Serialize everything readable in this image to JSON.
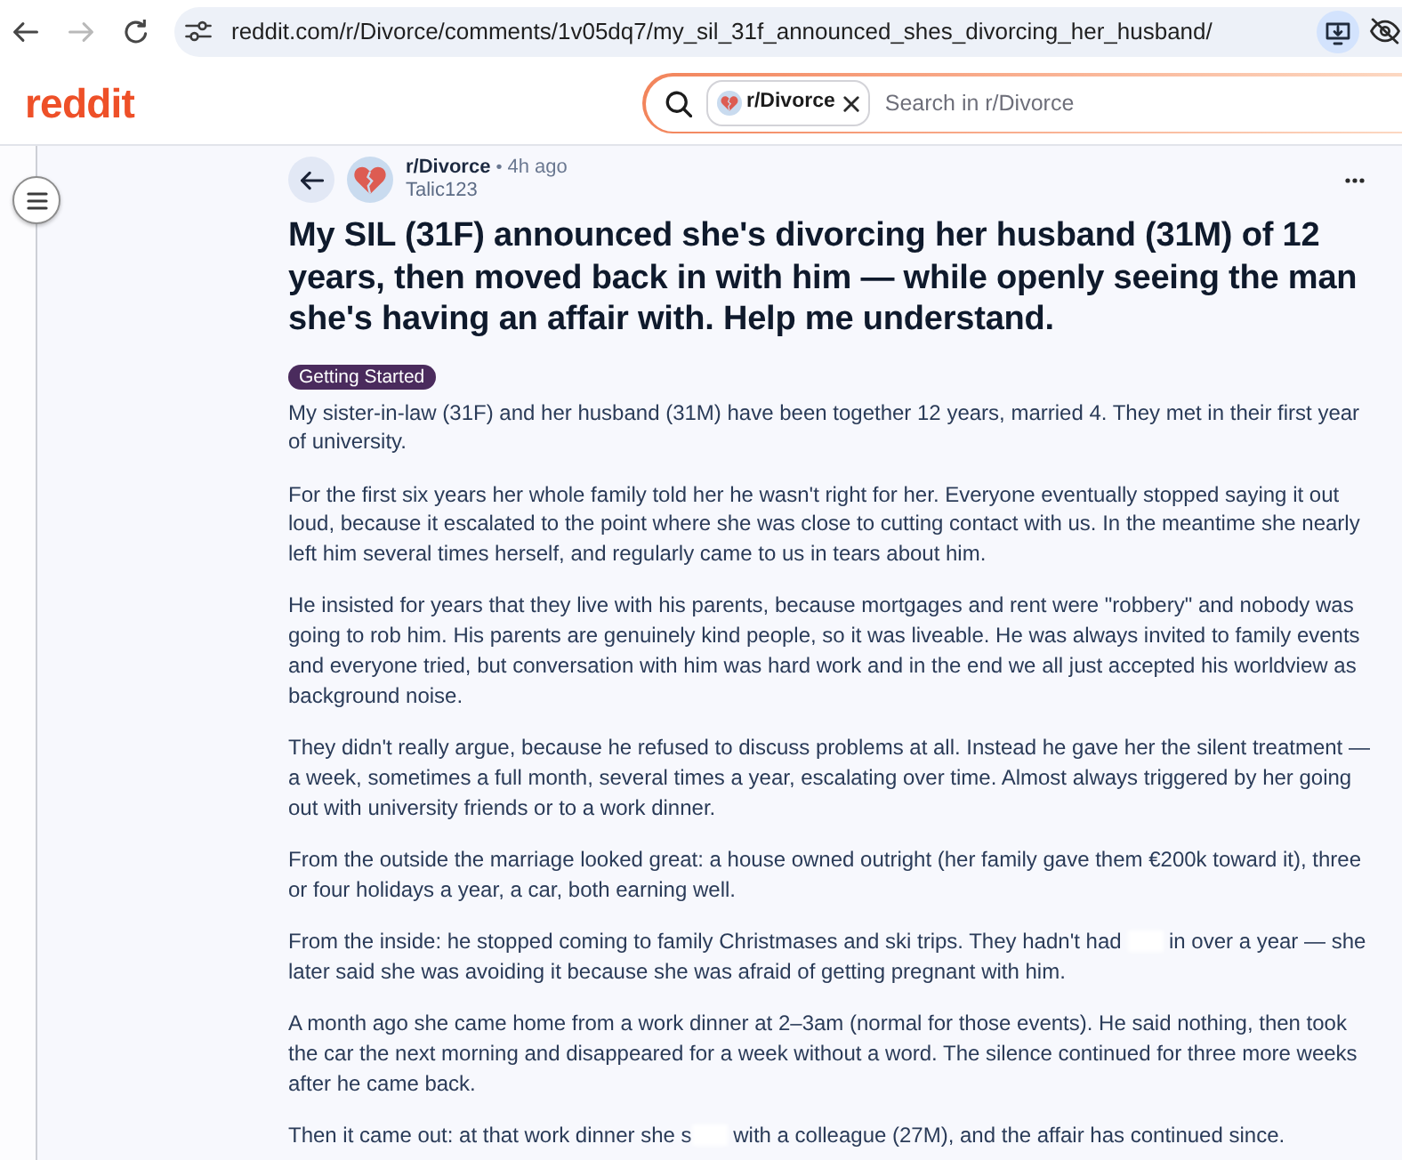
{
  "browser": {
    "nav": [
      {
        "kind": "back",
        "disabled": false
      },
      {
        "kind": "forward",
        "disabled": true
      },
      {
        "kind": "reload",
        "disabled": false
      }
    ],
    "url": "reddit.com/r/Divorce/comments/1v05dq7/my_sil_31f_announced_shes_divorcing_her_husband/"
  },
  "header": {
    "logo": "reddit",
    "search": {
      "chip": "r/Divorce",
      "placeholder": "Search in r/Divorce"
    }
  },
  "post": {
    "subreddit": "r/Divorce",
    "separator": "•",
    "time": "4h ago",
    "author": "Talic123",
    "title": "My SIL (31F) announced she's divorcing her husband (31M) of 12 years, then moved back in with him — while openly seeing the man she's having an affair with. Help me understand.",
    "flair": "Getting Started",
    "paragraphs": [
      {
        "segments": [
          {
            "kind": "text",
            "text": "My sister-in-law (31F) and her husband (31M) have been together 12 years, married 4. They met in their first year of university."
          }
        ]
      },
      {
        "segments": [
          {
            "kind": "text",
            "text": "For the first six years her whole family told her he wasn't right for her. Everyone eventually stopped saying it out loud, because it escalated to the point where she was close to cutting contact with us. In the meantime she nearly left him several times herself, and regularly came to us in tears about him."
          }
        ]
      },
      {
        "segments": [
          {
            "kind": "text",
            "text": "He insisted for years that they live with his parents, because mortgages and rent were \"robbery\" and nobody was going to rob him. His parents are genuinely kind people, so it was liveable. He was always invited to family events and everyone tried, but conversation with him was hard work and in the end we all just accepted his worldview as background noise."
          }
        ]
      },
      {
        "segments": [
          {
            "kind": "text",
            "text": "They didn't really argue, because he refused to discuss problems at all. Instead he gave her the silent treatment — a week, sometimes a full month, several times a year, escalating over time. Almost always triggered by her going out with university friends or to a work dinner."
          }
        ]
      },
      {
        "segments": [
          {
            "kind": "text",
            "text": "From the outside the marriage looked great: a house owned outright (her family gave them €200k toward it), three or four holidays a year, a car, both earning well."
          }
        ]
      },
      {
        "segments": [
          {
            "kind": "text",
            "text": "From the inside: he stopped coming to family Christmases and ski trips. They hadn't had "
          },
          {
            "kind": "redacted"
          },
          {
            "kind": "text",
            "text": " in over a year — she later said she was avoiding it because she was afraid of getting pregnant with him."
          }
        ]
      },
      {
        "segments": [
          {
            "kind": "text",
            "text": "A month ago she came home from a work dinner at 2–3am (normal for those events). He said nothing, then took the car the next morning and disappeared for a week without a word. The silence continued for three more weeks after he came back."
          }
        ]
      },
      {
        "segments": [
          {
            "kind": "text",
            "text": "Then it came out: at that work dinner she s"
          },
          {
            "kind": "redacted"
          },
          {
            "kind": "text",
            "text": " with a colleague (27M), and the affair has continued since."
          }
        ]
      }
    ]
  }
}
